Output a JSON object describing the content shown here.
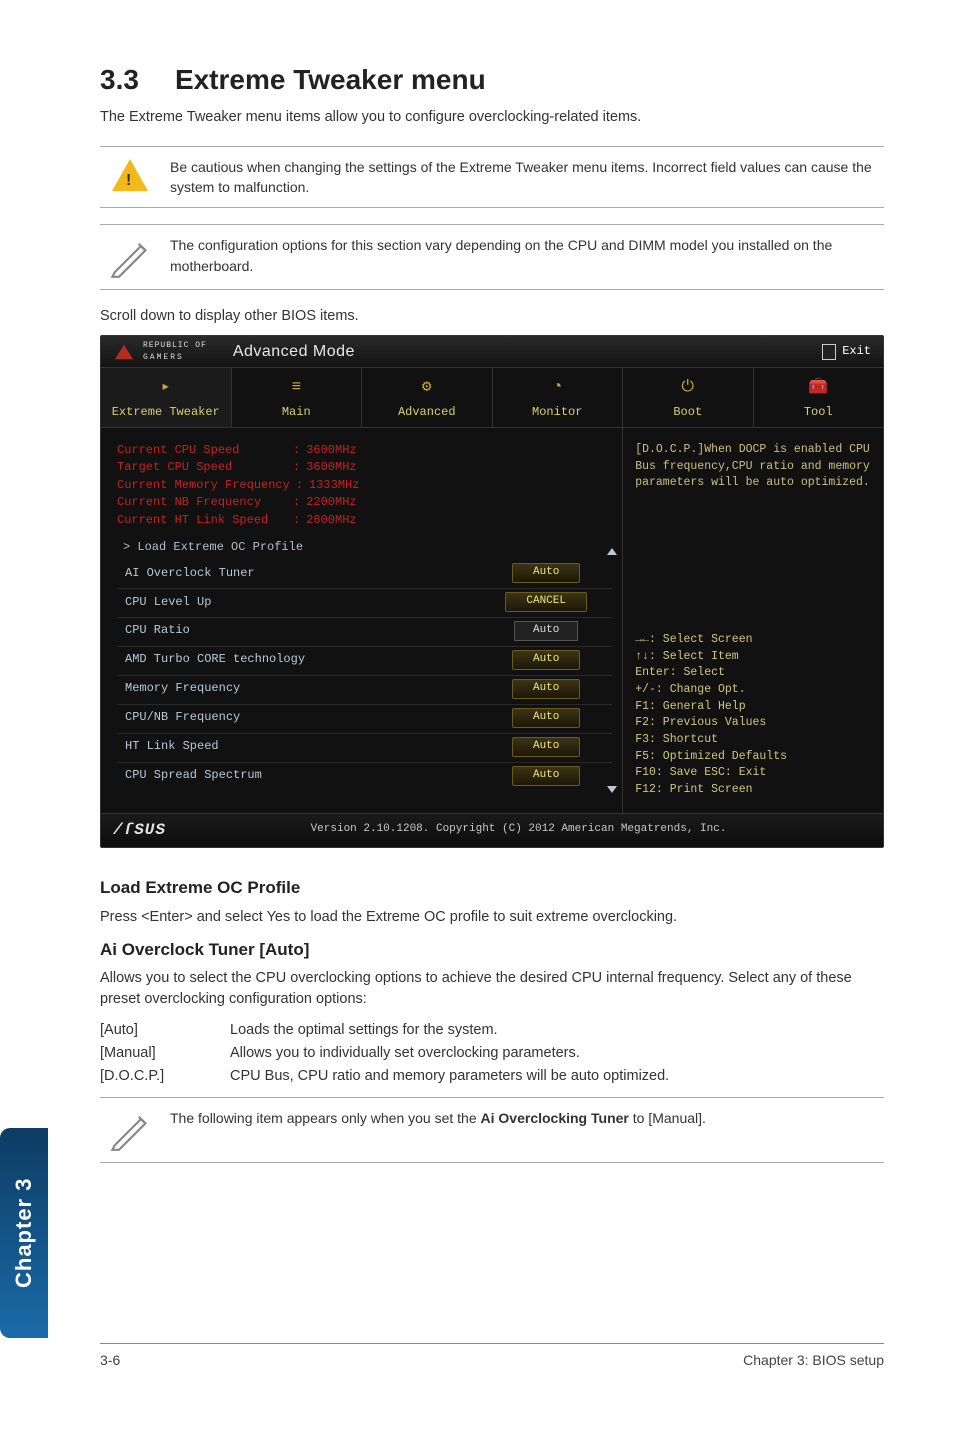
{
  "section": {
    "number": "3.3",
    "title": "Extreme Tweaker menu"
  },
  "intro": "The Extreme Tweaker menu items allow you to configure overclocking-related items.",
  "callout_warning": "Be cautious when changing the settings of the Extreme Tweaker menu items. Incorrect field values can cause the system to malfunction.",
  "callout_note1": "The configuration options for this section vary depending on the CPU and DIMM model you installed on the motherboard.",
  "scroll_hint": "Scroll down to display other BIOS items.",
  "bios": {
    "brand_small": "REPUBLIC OF",
    "brand_sub": "GAMERS",
    "mode": "Advanced Mode",
    "exit": "Exit",
    "tabs": [
      "Extreme Tweaker",
      "Main",
      "Advanced",
      "Monitor",
      "Boot",
      "Tool"
    ],
    "specs": [
      {
        "label": "Current CPU Speed",
        "value": "3600MHz"
      },
      {
        "label": "Target CPU Speed",
        "value": "3600MHz"
      },
      {
        "label": "Current Memory Frequency",
        "value": "1333MHz"
      },
      {
        "label": "Current NB Frequency",
        "value": "2200MHz"
      },
      {
        "label": "Current HT Link Speed",
        "value": "2600MHz"
      }
    ],
    "load_profile": "> Load Extreme OC Profile",
    "rows": [
      {
        "label": "AI Overclock Tuner",
        "value": "Auto",
        "kind": "btn"
      },
      {
        "label": "CPU Level Up",
        "value": "CANCEL",
        "kind": "btn"
      },
      {
        "label": "CPU Ratio",
        "value": "Auto",
        "kind": "input"
      },
      {
        "label": "AMD Turbo CORE technology",
        "value": "Auto",
        "kind": "btn"
      },
      {
        "label": "Memory Frequency",
        "value": "Auto",
        "kind": "btn"
      },
      {
        "label": "CPU/NB Frequency",
        "value": "Auto",
        "kind": "btn"
      },
      {
        "label": "HT Link Speed",
        "value": "Auto",
        "kind": "btn"
      },
      {
        "label": "CPU Spread Spectrum",
        "value": "Auto",
        "kind": "btn"
      }
    ],
    "help_text": "[D.O.C.P.]When DOCP is enabled CPU Bus frequency,CPU ratio and memory parameters will be auto optimized.",
    "keys": [
      "→←: Select Screen",
      "↑↓: Select Item",
      "Enter: Select",
      "+/-: Change Opt.",
      "F1: General Help",
      "F2: Previous Values",
      "F3: Shortcut",
      "F5: Optimized Defaults",
      "F10: Save  ESC: Exit",
      "F12: Print Screen"
    ],
    "footer_logo": "/ſSUS",
    "footer_copy": "Version 2.10.1208. Copyright (C) 2012 American Megatrends, Inc."
  },
  "load_profile_heading": "Load Extreme OC Profile",
  "load_profile_text": "Press <Enter> and select Yes to load the Extreme OC profile to suit extreme overclocking.",
  "ai_heading": "Ai Overclock Tuner [Auto]",
  "ai_text": "Allows you to select the CPU overclocking options to achieve the desired CPU internal frequency. Select any of these preset overclocking configuration options:",
  "options": [
    {
      "key": "[Auto]",
      "desc": "Loads the optimal settings for the system."
    },
    {
      "key": "[Manual]",
      "desc": "Allows you to individually set overclocking parameters."
    },
    {
      "key": "[D.O.C.P.]",
      "desc": "CPU Bus, CPU ratio and memory parameters will be auto optimized."
    }
  ],
  "callout_note2_pre": "The following item appears only when you set the ",
  "callout_note2_bold": "Ai Overclocking Tuner",
  "callout_note2_post": " to [Manual].",
  "side_tab": "Chapter 3",
  "footer_left": "3-6",
  "footer_right": "Chapter 3: BIOS setup"
}
